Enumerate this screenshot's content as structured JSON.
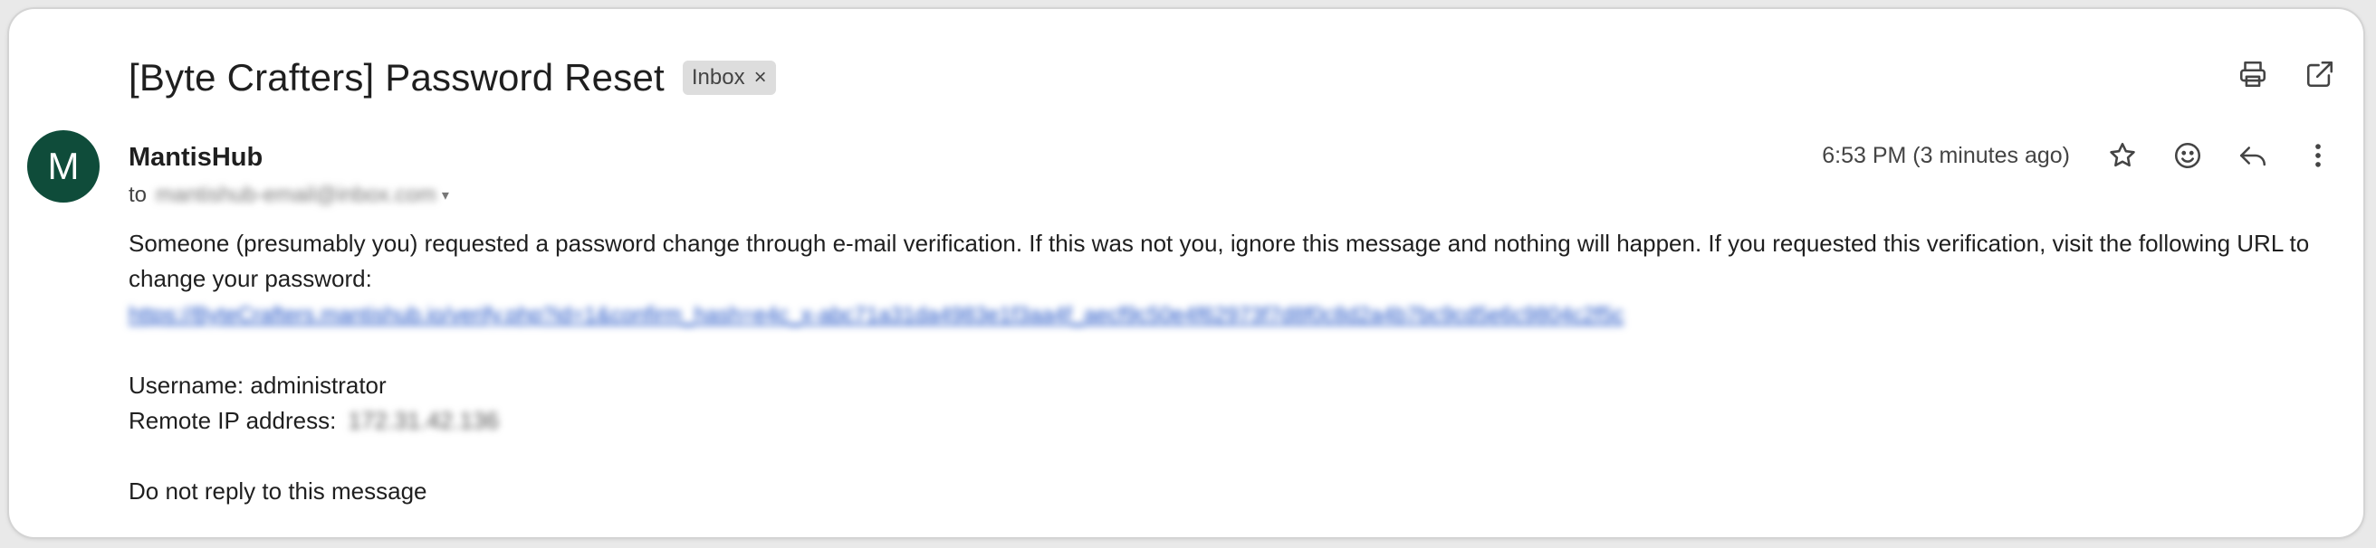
{
  "email": {
    "subject": "[Byte Crafters] Password Reset",
    "label": "Inbox",
    "label_remove": "×",
    "sender_initial": "M",
    "sender_name": "MantisHub",
    "to_prefix": "to",
    "to_address": "mantishub-email@inbox.com",
    "time": "6:53 PM (3 minutes ago)",
    "body": {
      "intro": "Someone (presumably you) requested a password change through e-mail verification. If this was not you, ignore this message and nothing will happen. If you requested this verification, visit the following URL to change your password:",
      "link": "https://ByteCrafters.mantishub.io/verify.php?id=1&confirm_hash=e4c_x-abc71a31da4983e1f3aa4f_aecf9c50e4f62973f7d8f0c8d2a4b7bc9cd5e6c9804c2f5c",
      "username_label": "Username: administrator",
      "ip_label": "Remote IP address:",
      "ip_value": "172.31.42.136",
      "footer": "Do not reply to this message"
    }
  },
  "icons": {
    "print": "print-icon",
    "open_new_window": "open-in-new-icon",
    "star": "star-icon",
    "emoji": "emoji-icon",
    "reply": "reply-icon",
    "more": "more-vert-icon"
  },
  "colors": {
    "avatar_bg": "#0f4c3a",
    "link": "#1a4ec4",
    "chip_bg": "#dddddd"
  }
}
